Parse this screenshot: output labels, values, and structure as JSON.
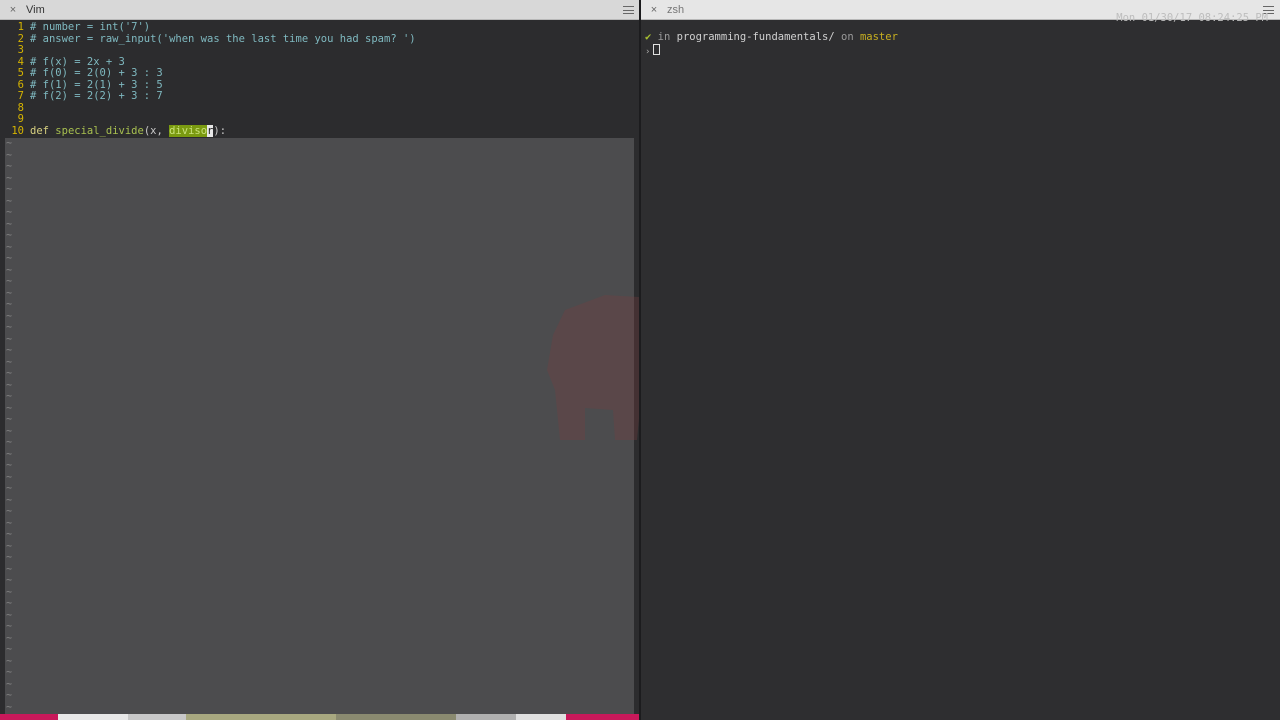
{
  "left_pane": {
    "title": "Vim",
    "close_glyph": "×",
    "lines": [
      {
        "num": "1",
        "text": "# number = int('7')"
      },
      {
        "num": "2",
        "text": "# answer = raw_input('when was the last time you had spam? ')"
      },
      {
        "num": "3",
        "text": ""
      },
      {
        "num": "4",
        "text": "# f(x) = 2x + 3"
      },
      {
        "num": "5",
        "text": "# f(0) = 2(0) + 3 : 3"
      },
      {
        "num": "6",
        "text": "# f(1) = 2(1) + 3 : 5"
      },
      {
        "num": "7",
        "text": "# f(2) = 2(2) + 3 : 7"
      },
      {
        "num": "8",
        "text": ""
      },
      {
        "num": "9",
        "text": ""
      }
    ],
    "code_line": {
      "num": "10",
      "keyword": "def",
      "fn_name": "special_divide",
      "open": "(x, ",
      "highlight": "diviso",
      "cursor_char": "r",
      "close": "):"
    },
    "tilde_char": "~",
    "statusbar_colors": [
      "#c8185a",
      "#e8e8e8",
      "#c8c8c8",
      "#a8a880",
      "#8a8a70",
      "#b0b0b0",
      "#e0e0e0",
      "#c8185a"
    ]
  },
  "right_pane": {
    "title": "zsh",
    "close_glyph": "×",
    "check_glyph": "✔",
    "in_word": " in ",
    "directory": "programming-fundamentals/",
    "on_word": " on ",
    "branch": "master",
    "prompt_glyph": "›",
    "timestamp": "Mon 01/30/17 08:24:25 PM"
  },
  "colors": {
    "line_number": "#d6b400",
    "comment": "#7fb9c0",
    "highlight_bg": "#7a9a10"
  },
  "icons": [
    "close-icon",
    "hamburger-menu-icon",
    "elephant-logo-icon",
    "checkmark-icon",
    "cursor-icon"
  ]
}
